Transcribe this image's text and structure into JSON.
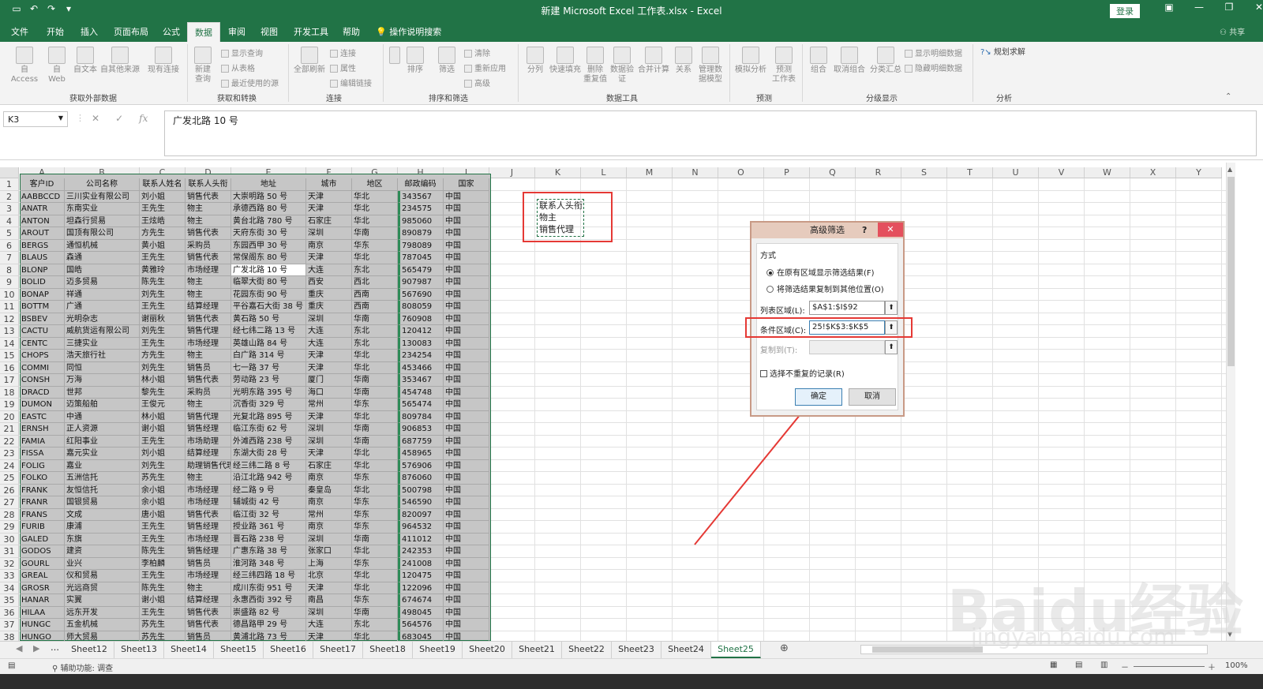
{
  "window": {
    "title": "新建 Microsoft Excel 工作表.xlsx - Excel",
    "login": "登录",
    "share": "共享"
  },
  "ribbon_tabs": [
    "文件",
    "开始",
    "插入",
    "页面布局",
    "公式",
    "数据",
    "审阅",
    "视图",
    "开发工具",
    "帮助",
    "操作说明搜索"
  ],
  "active_tab": "数据",
  "ribbon": {
    "external": {
      "access": "自 Access",
      "web": "自\nWeb",
      "text": "自文本",
      "other": "自其他来源",
      "existing": "现有连接",
      "label": "获取外部数据"
    },
    "transform": {
      "new_query": "新建\n查询",
      "show_query": "显示查询",
      "from_table": "从表格",
      "recent": "最近使用的源",
      "label": "获取和转换"
    },
    "connections": {
      "refresh_all": "全部刷新",
      "conn": "连接",
      "props": "属性",
      "edit_links": "编辑链接",
      "label": "连接"
    },
    "sortfilter": {
      "sort": "排序",
      "filter": "筛选",
      "clear": "清除",
      "reapply": "重新应用",
      "advanced": "高级",
      "label": "排序和筛选"
    },
    "datatools": {
      "split": "分列",
      "flash": "快速填充",
      "remove_dup": "删除\n重复值",
      "validate": "数据验\n证",
      "consolidate": "合并计算",
      "relations": "关系",
      "manage": "管理数\n据模型",
      "label": "数据工具"
    },
    "forecast": {
      "whatif": "模拟分析",
      "sheet": "预测\n工作表",
      "label": "预测"
    },
    "outline": {
      "group": "组合",
      "ungroup": "取消组合",
      "subtotal": "分类汇总",
      "show": "显示明细数据",
      "hide": "隐藏明细数据",
      "label": "分级显示"
    },
    "analysis": {
      "solver": "规划求解",
      "label": "分析"
    }
  },
  "formula_bar": {
    "name_box": "K3",
    "content": "广发北路 10 号"
  },
  "columns": [
    "A",
    "B",
    "C",
    "D",
    "E",
    "F",
    "G",
    "H",
    "I",
    "J",
    "K",
    "L",
    "M",
    "N",
    "O",
    "P",
    "Q",
    "R",
    "S",
    "T",
    "U",
    "V",
    "W",
    "X",
    "Y"
  ],
  "table_headers": [
    "客户ID",
    "公司名称",
    "联系人姓名",
    "联系人头衔",
    "地址",
    "城市",
    "地区",
    "邮政编码",
    "国家"
  ],
  "rows": [
    [
      "AABBCCD",
      "三川实业有限公司",
      "刘小姐",
      "销售代表",
      "大崇明路 50 号",
      "天津",
      "华北",
      "343567",
      "中国"
    ],
    [
      "ANATR",
      "东南实业",
      "王先生",
      "物主",
      "承德西路 80 号",
      "天津",
      "华北",
      "234575",
      "中国"
    ],
    [
      "ANTON",
      "坦森行贸易",
      "王炫皓",
      "物主",
      "黄台北路 780 号",
      "石家庄",
      "华北",
      "985060",
      "中国"
    ],
    [
      "AROUT",
      "国顶有限公司",
      "方先生",
      "销售代表",
      "天府东街 30 号",
      "深圳",
      "华南",
      "890879",
      "中国"
    ],
    [
      "BERGS",
      "通恒机械",
      "黄小姐",
      "采购员",
      "东园西甲 30 号",
      "南京",
      "华东",
      "798089",
      "中国"
    ],
    [
      "BLAUS",
      "森通",
      "王先生",
      "销售代表",
      "常保阁东 80 号",
      "天津",
      "华北",
      "787045",
      "中国"
    ],
    [
      "BLONP",
      "国皓",
      "黄雅玲",
      "市场经理",
      "广发北路 10 号",
      "大连",
      "东北",
      "565479",
      "中国"
    ],
    [
      "BOLID",
      "迈多贸易",
      "陈先生",
      "物主",
      "临翠大街 80 号",
      "西安",
      "西北",
      "907987",
      "中国"
    ],
    [
      "BONAP",
      "祥通",
      "刘先生",
      "物主",
      "花园东街 90 号",
      "重庆",
      "西南",
      "567690",
      "中国"
    ],
    [
      "BOTTM",
      "广通",
      "王先生",
      "结算经理",
      "平谷嘉石大街 38 号",
      "重庆",
      "西南",
      "808059",
      "中国"
    ],
    [
      "BSBEV",
      "光明杂志",
      "谢丽秋",
      "销售代表",
      "黄石路 50 号",
      "深圳",
      "华南",
      "760908",
      "中国"
    ],
    [
      "CACTU",
      "威航货运有限公司",
      "刘先生",
      "销售代理",
      "经七纬二路 13 号",
      "大连",
      "东北",
      "120412",
      "中国"
    ],
    [
      "CENTC",
      "三捷实业",
      "王先生",
      "市场经理",
      "英雄山路 84 号",
      "大连",
      "东北",
      "130083",
      "中国"
    ],
    [
      "CHOPS",
      "浩天旅行社",
      "方先生",
      "物主",
      "白广路 314 号",
      "天津",
      "华北",
      "234254",
      "中国"
    ],
    [
      "COMMI",
      "同恒",
      "刘先生",
      "销售员",
      "七一路 37 号",
      "天津",
      "华北",
      "453466",
      "中国"
    ],
    [
      "CONSH",
      "万海",
      "林小姐",
      "销售代表",
      "劳动路 23 号",
      "厦门",
      "华南",
      "353467",
      "中国"
    ],
    [
      "DRACD",
      "世邦",
      "黎先生",
      "采购员",
      "光明东路 395 号",
      "海口",
      "华南",
      "454748",
      "中国"
    ],
    [
      "DUMON",
      "迈策船舶",
      "王俊元",
      "物主",
      "沉香街 329 号",
      "常州",
      "华东",
      "565474",
      "中国"
    ],
    [
      "EASTC",
      "中通",
      "林小姐",
      "销售代理",
      "光复北路 895 号",
      "天津",
      "华北",
      "809784",
      "中国"
    ],
    [
      "ERNSH",
      "正人资源",
      "谢小姐",
      "销售经理",
      "临江东街 62 号",
      "深圳",
      "华南",
      "906853",
      "中国"
    ],
    [
      "FAMIA",
      "红阳事业",
      "王先生",
      "市场助理",
      "外滩西路 238 号",
      "深圳",
      "华南",
      "687759",
      "中国"
    ],
    [
      "FISSA",
      "嘉元实业",
      "刘小姐",
      "结算经理",
      "东湖大街 28 号",
      "天津",
      "华北",
      "458965",
      "中国"
    ],
    [
      "FOLIG",
      "嘉业",
      "刘先生",
      "助理销售代理",
      "经三纬二路 8 号",
      "石家庄",
      "华北",
      "576906",
      "中国"
    ],
    [
      "FOLKO",
      "五洲信托",
      "苏先生",
      "物主",
      "沿江北路 942 号",
      "南京",
      "华东",
      "876060",
      "中国"
    ],
    [
      "FRANK",
      "友恒信托",
      "余小姐",
      "市场经理",
      "经二路 9 号",
      "秦皇岛",
      "华北",
      "500798",
      "中国"
    ],
    [
      "FRANR",
      "国银贸易",
      "余小姐",
      "市场经理",
      "辅城街 42 号",
      "南京",
      "华东",
      "546590",
      "中国"
    ],
    [
      "FRANS",
      "文成",
      "唐小姐",
      "销售代表",
      "临江街 32 号",
      "常州",
      "华东",
      "820097",
      "中国"
    ],
    [
      "FURIB",
      "康浦",
      "王先生",
      "销售经理",
      "授业路 361 号",
      "南京",
      "华东",
      "964532",
      "中国"
    ],
    [
      "GALED",
      "东旗",
      "王先生",
      "市场经理",
      "晋石路 238 号",
      "深圳",
      "华南",
      "411012",
      "中国"
    ],
    [
      "GODOS",
      "建资",
      "陈先生",
      "销售经理",
      "广惠东路 38 号",
      "张家口",
      "华北",
      "242353",
      "中国"
    ],
    [
      "GOURL",
      "业兴",
      "李柏麟",
      "销售员",
      "淮河路 348 号",
      "上海",
      "华东",
      "241008",
      "中国"
    ],
    [
      "GREAL",
      "仪和贸易",
      "王先生",
      "市场经理",
      "经三纬四路 18 号",
      "北京",
      "华北",
      "120475",
      "中国"
    ],
    [
      "GROSR",
      "光远商贸",
      "陈先生",
      "物主",
      "成川东街 951 号",
      "天津",
      "华北",
      "122096",
      "中国"
    ],
    [
      "HANAR",
      "实翼",
      "谢小姐",
      "结算经理",
      "永惠西街 392 号",
      "南昌",
      "华东",
      "674674",
      "中国"
    ],
    [
      "HILAA",
      "远东开发",
      "王先生",
      "销售代表",
      "崇盛路 82 号",
      "深圳",
      "华南",
      "498045",
      "中国"
    ],
    [
      "HUNGC",
      "五金机械",
      "苏先生",
      "销售代表",
      "德昌路甲 29 号",
      "大连",
      "东北",
      "564576",
      "中国"
    ],
    [
      "HUNGO",
      "师大贸易",
      "苏先生",
      "销售员",
      "黄浦北路 73 号",
      "天津",
      "华北",
      "683045",
      "中国"
    ]
  ],
  "criteria": [
    "联系人头衔",
    "物主",
    "销售代理"
  ],
  "dialog": {
    "title": "高级筛选",
    "help": "?",
    "close": "✕",
    "mode_label": "方式",
    "opt1": "在原有区域显示筛选结果(F)",
    "opt2": "将筛选结果复制到其他位置(O)",
    "list_label": "列表区域(L):",
    "list_value": "$A$1:$I$92",
    "crit_label": "条件区域(C):",
    "crit_value": "25!$K$3:$K$5",
    "copy_label": "复制到(T):",
    "unique_label": "选择不重复的记录(R)",
    "ok": "确定",
    "cancel": "取消"
  },
  "sheets": [
    "Sheet12",
    "Sheet13",
    "Sheet14",
    "Sheet15",
    "Sheet16",
    "Sheet17",
    "Sheet18",
    "Sheet19",
    "Sheet20",
    "Sheet21",
    "Sheet22",
    "Sheet23",
    "Sheet24",
    "Sheet25"
  ],
  "active_sheet": "Sheet25",
  "status": {
    "accessibility": "辅助功能: 调查",
    "zoom": "100%"
  },
  "watermark": {
    "brand": "Baidu经验",
    "url": "jingyan.baidu.com"
  }
}
